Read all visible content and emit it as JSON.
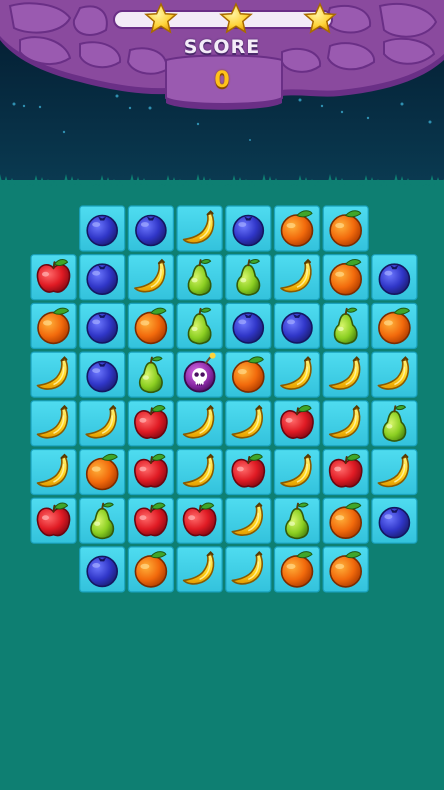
{
  "hud": {
    "score_label": "SCORE",
    "score_value": "0",
    "progress_fraction": 0,
    "stars_total": 3
  },
  "colors": {
    "sky": "#062a44",
    "rock": "#8a4a9e",
    "field": "#0e7f72",
    "tile": "#3ed0e6",
    "star": "#ffd43a",
    "score_value": "#ffc21a"
  },
  "board": {
    "rows": [
      [
        null,
        "blueberry",
        "blueberry",
        "banana",
        "blueberry",
        "orange",
        "orange",
        null
      ],
      [
        "apple",
        "blueberry",
        "banana",
        "pear",
        "pear",
        "banana",
        "orange",
        "blueberry"
      ],
      [
        "orange",
        "blueberry",
        "orange",
        "pear",
        "blueberry",
        "blueberry",
        "pear",
        "orange"
      ],
      [
        "banana",
        "blueberry",
        "pear",
        "skull-bomb",
        "orange",
        "banana",
        "banana",
        "banana"
      ],
      [
        "banana",
        "banana",
        "apple",
        "banana",
        "banana",
        "apple",
        "banana",
        "pear"
      ],
      [
        "banana",
        "orange",
        "apple",
        "banana",
        "apple",
        "banana",
        "apple",
        "banana"
      ],
      [
        "apple",
        "pear",
        "apple",
        "apple",
        "banana",
        "pear",
        "orange",
        "blueberry"
      ],
      [
        null,
        "blueberry",
        "orange",
        "banana",
        "banana",
        "orange",
        "orange",
        null
      ]
    ]
  }
}
